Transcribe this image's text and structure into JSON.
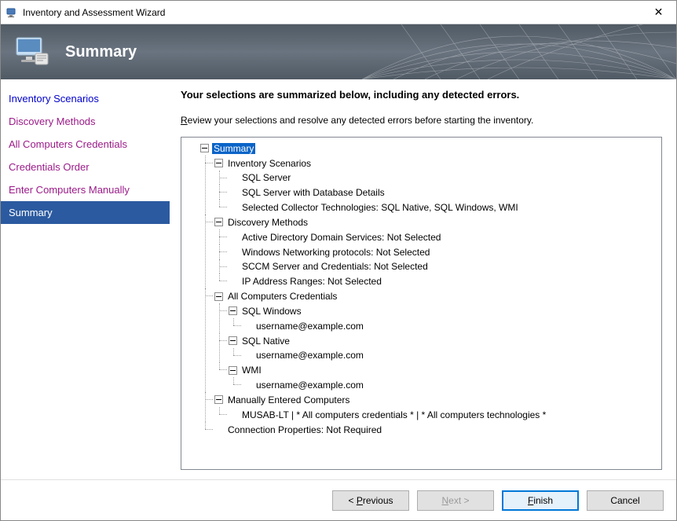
{
  "window": {
    "title": "Inventory and Assessment Wizard"
  },
  "banner": {
    "title": "Summary"
  },
  "sidebar": {
    "items": [
      {
        "label": "Inventory Scenarios",
        "state": "link"
      },
      {
        "label": "Discovery Methods",
        "state": "visited"
      },
      {
        "label": "All Computers Credentials",
        "state": "visited"
      },
      {
        "label": "Credentials Order",
        "state": "visited"
      },
      {
        "label": "Enter Computers Manually",
        "state": "visited"
      },
      {
        "label": "Summary",
        "state": "active"
      }
    ]
  },
  "content": {
    "heading": "Your selections are summarized below, including any detected errors.",
    "subtext_prefix_u": "R",
    "subtext_rest": "eview your selections and resolve any detected errors before starting the inventory."
  },
  "tree": {
    "root": "Summary",
    "inventory_scenarios": {
      "label": "Inventory Scenarios",
      "items": [
        "SQL Server",
        "SQL Server with Database Details",
        "Selected Collector Technologies: SQL Native, SQL Windows, WMI"
      ]
    },
    "discovery_methods": {
      "label": "Discovery Methods",
      "items": [
        "Active Directory Domain Services: Not Selected",
        "Windows Networking protocols: Not Selected",
        "SCCM Server and Credentials: Not Selected",
        "IP Address Ranges: Not Selected"
      ]
    },
    "credentials": {
      "label": "All Computers Credentials",
      "groups": [
        {
          "name": "SQL Windows",
          "user": "username@example.com"
        },
        {
          "name": "SQL Native",
          "user": "username@example.com"
        },
        {
          "name": "WMI",
          "user": "username@example.com"
        }
      ]
    },
    "manual": {
      "label": "Manually Entered Computers",
      "items": [
        "MUSAB-LT | * All computers credentials * | * All computers technologies *"
      ]
    },
    "connection": "Connection Properties: Not Required"
  },
  "buttons": {
    "previous": "< Previous",
    "previous_u": "P",
    "next": "Next >",
    "next_u": "N",
    "finish": "Finish",
    "finish_u": "F",
    "cancel": "Cancel"
  }
}
